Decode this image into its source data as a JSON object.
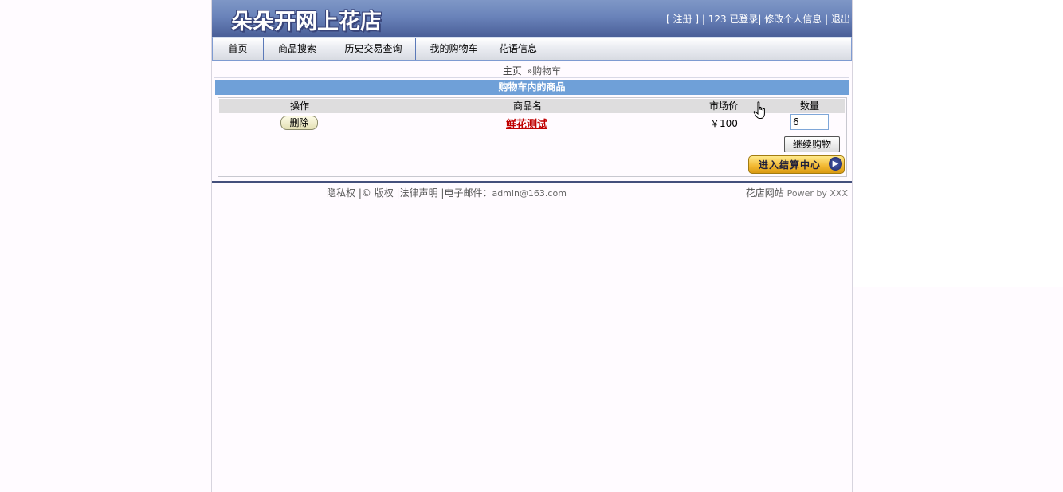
{
  "header": {
    "logo_text": "朵朵开网上花店",
    "links": {
      "register": "[ 注册 ]",
      "sep1": " | ",
      "logged_in": "123 已登录",
      "sep2": "| ",
      "edit_profile": "修改个人信息",
      "sep3": " | ",
      "logout": "退出"
    }
  },
  "nav": {
    "items": [
      "首页",
      "商品搜索",
      "历史交易查询",
      "我的购物车",
      "花语信息"
    ]
  },
  "breadcrumb": {
    "home": "主页",
    "current": "»购物车"
  },
  "cart": {
    "title": "购物车内的商品",
    "columns": {
      "action": "操作",
      "name": "商品名",
      "price": "市场价",
      "qty": "数量"
    },
    "rows": [
      {
        "delete_label": "删除",
        "name": "鲜花测试",
        "price": "￥100",
        "qty": "6"
      }
    ],
    "continue_label": "继续购物",
    "checkout_label": "进入结算中心"
  },
  "footer": {
    "privacy": "隐私权",
    "copyright": "|© 版权",
    "legal": "|法律声明",
    "email_label": "|电子邮件：",
    "email": "admin@163.com",
    "site": "花店网站",
    "powered": "Power by XXX"
  },
  "colors": {
    "header_bg": "#6a83ba",
    "cart_title_bg": "#6fa0d8",
    "product_link": "#c00000",
    "checkout_gold": "#f2b730"
  }
}
